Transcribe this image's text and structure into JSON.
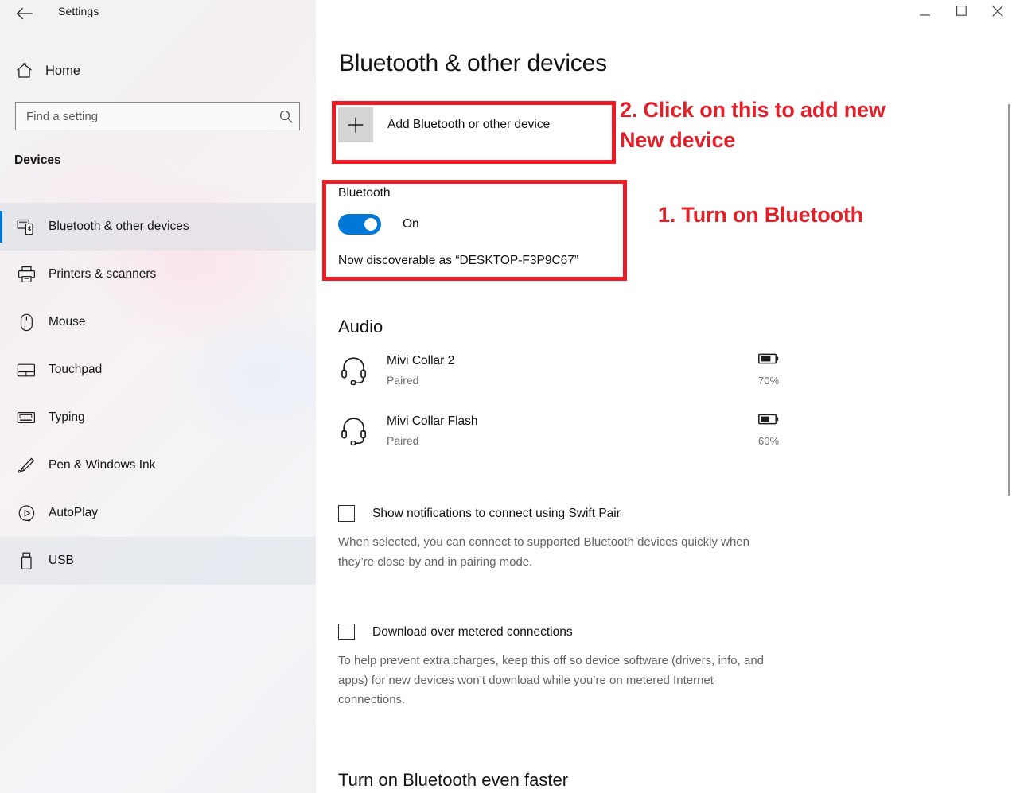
{
  "window": {
    "title": "Settings",
    "back_icon": "back-arrow-icon",
    "controls": {
      "minimize": "minimize-icon",
      "maximize": "maximize-icon",
      "close": "close-icon"
    }
  },
  "sidebar": {
    "home": {
      "label": "Home",
      "icon": "home-icon"
    },
    "search": {
      "value": "",
      "placeholder": "Find a setting",
      "icon": "search-icon"
    },
    "section_header": "Devices",
    "items": [
      {
        "label": "Bluetooth & other devices",
        "icon": "bluetooth-devices-icon",
        "selected": true
      },
      {
        "label": "Printers & scanners",
        "icon": "printer-icon",
        "selected": false
      },
      {
        "label": "Mouse",
        "icon": "mouse-icon",
        "selected": false
      },
      {
        "label": "Touchpad",
        "icon": "touchpad-icon",
        "selected": false
      },
      {
        "label": "Typing",
        "icon": "keyboard-icon",
        "selected": false
      },
      {
        "label": "Pen & Windows Ink",
        "icon": "pen-icon",
        "selected": false
      },
      {
        "label": "AutoPlay",
        "icon": "autoplay-icon",
        "selected": false
      },
      {
        "label": "USB",
        "icon": "usb-icon",
        "selected": false
      }
    ]
  },
  "main": {
    "page_title": "Bluetooth & other devices",
    "add_device": {
      "label": "Add Bluetooth or other device",
      "icon": "plus-icon"
    },
    "bluetooth": {
      "heading": "Bluetooth",
      "toggle_state": "On",
      "toggle_on": true,
      "discoverable_text": "Now discoverable as “DESKTOP-F3P9C67”"
    },
    "audio": {
      "heading": "Audio",
      "devices": [
        {
          "name": "Mivi Collar 2",
          "status": "Paired",
          "battery": "70%",
          "battery_level": 70,
          "icon": "headset-icon"
        },
        {
          "name": "Mivi Collar Flash",
          "status": "Paired",
          "battery": "60%",
          "battery_level": 60,
          "icon": "headset-icon"
        }
      ]
    },
    "options": [
      {
        "label": "Show notifications to connect using Swift Pair",
        "checked": false,
        "description": "When selected, you can connect to supported Bluetooth devices quickly when they’re close by and in pairing mode."
      },
      {
        "label": "Download over metered connections",
        "checked": false,
        "description": "To help prevent extra charges, keep this off so device software (drivers, info, and apps) for new devices won’t download while you’re on metered Internet connections."
      }
    ],
    "footer_section": "Turn on Bluetooth even faster"
  },
  "annotations": [
    {
      "id": "step2",
      "text": "2. Click on this to add new\nNew device"
    },
    {
      "id": "step1",
      "text": "1. Turn on Bluetooth"
    }
  ],
  "colors": {
    "accent": "#0078d7",
    "annotation_red": "#ed1c24",
    "sidebar_bg": "#f2f2f4",
    "main_bg": "#ffffff",
    "muted_text": "#6b6b6b"
  }
}
